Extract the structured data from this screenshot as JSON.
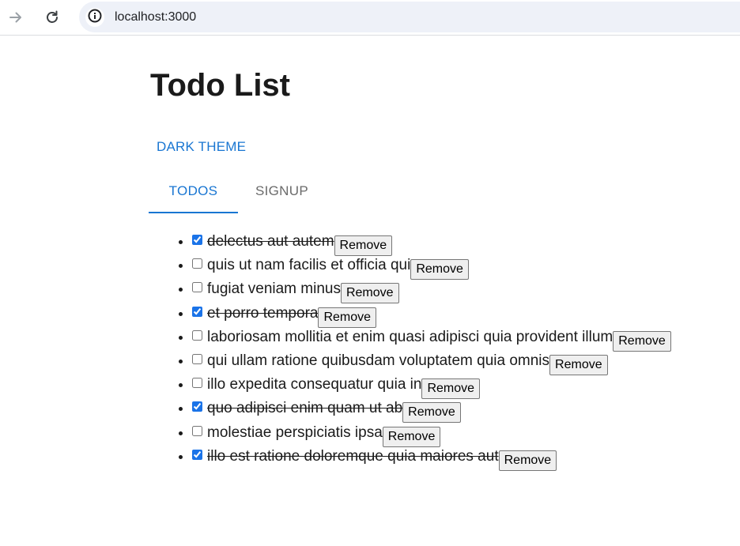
{
  "browser": {
    "url": "localhost:3000",
    "icons": {
      "forward": "arrow-right-icon",
      "reload": "reload-icon",
      "site_info": "info-icon"
    }
  },
  "app": {
    "title": "Todo List",
    "theme_toggle_label": "DARK THEME",
    "tabs": [
      {
        "label": "TODOS",
        "selected": true
      },
      {
        "label": "SIGNUP",
        "selected": false
      }
    ],
    "accent_color": "#1976d2",
    "remove_label": "Remove",
    "todos": [
      {
        "text": "delectus aut autem",
        "completed": true
      },
      {
        "text": "quis ut nam facilis et officia qui",
        "completed": false
      },
      {
        "text": "fugiat veniam minus",
        "completed": false
      },
      {
        "text": "et porro tempora",
        "completed": true
      },
      {
        "text": "laboriosam mollitia et enim quasi adipisci quia provident illum",
        "completed": false
      },
      {
        "text": "qui ullam ratione quibusdam voluptatem quia omnis",
        "completed": false
      },
      {
        "text": "illo expedita consequatur quia in",
        "completed": false
      },
      {
        "text": "quo adipisci enim quam ut ab",
        "completed": true
      },
      {
        "text": "molestiae perspiciatis ipsa",
        "completed": false
      },
      {
        "text": "illo est ratione doloremque quia maiores aut",
        "completed": true
      }
    ]
  }
}
